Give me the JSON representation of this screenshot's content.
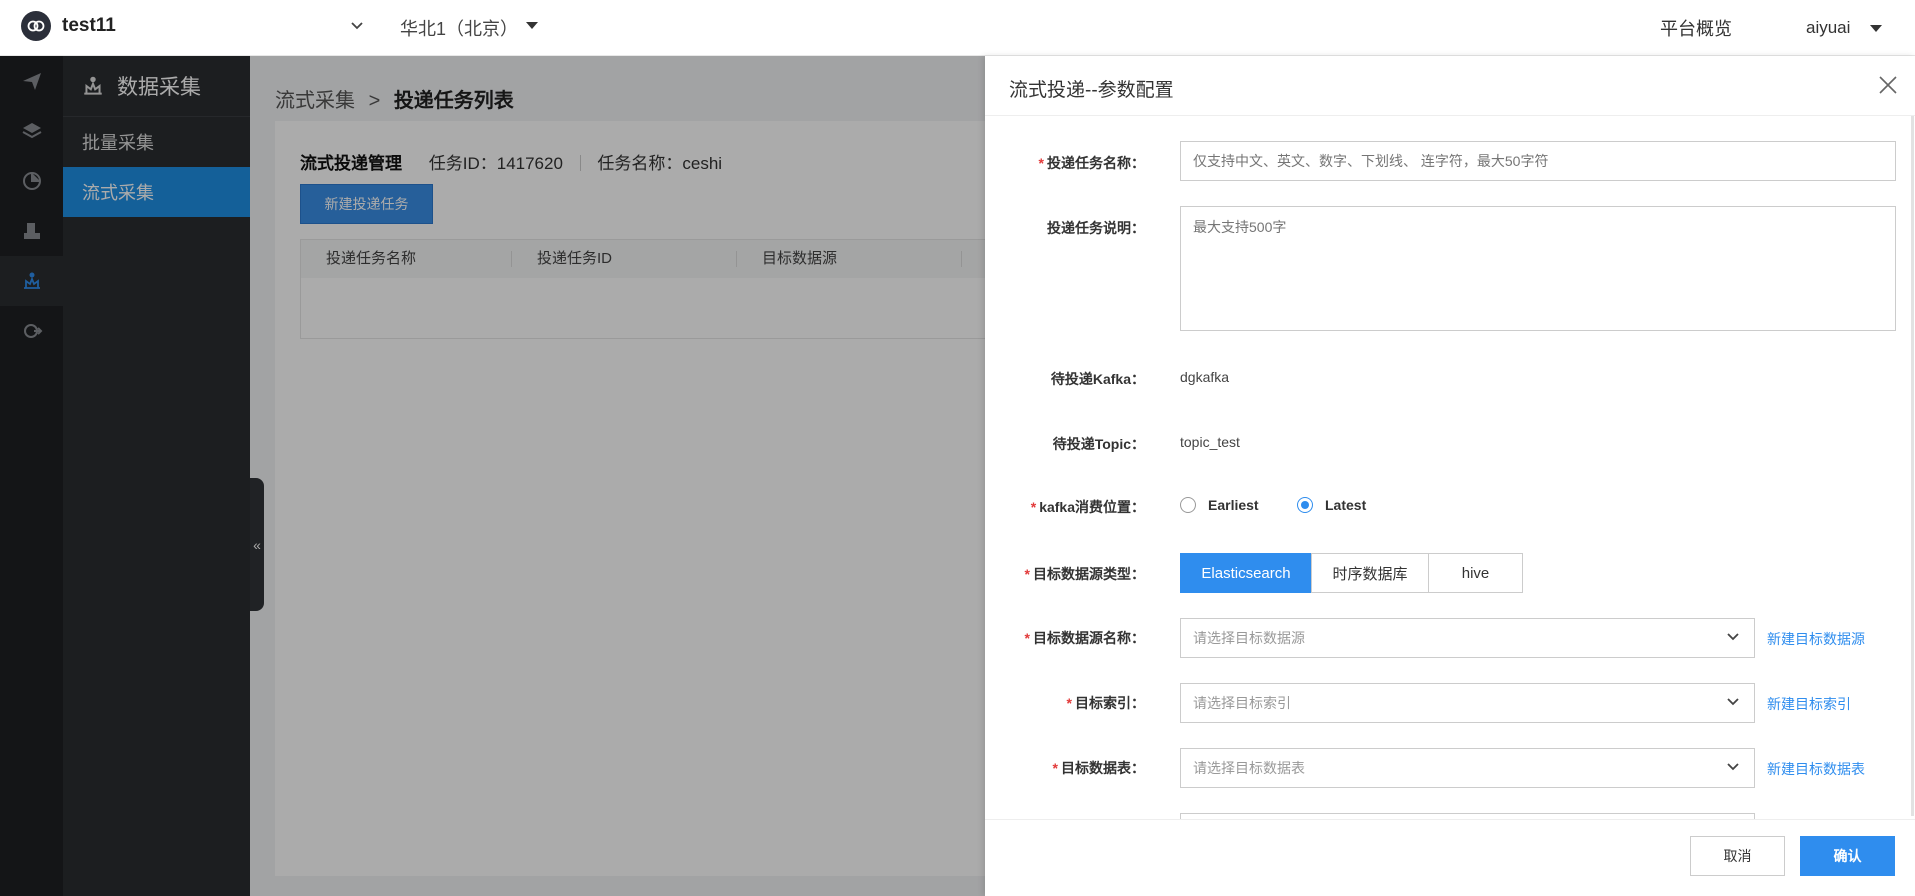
{
  "header": {
    "project": "test11",
    "region": "华北1（北京）",
    "overview": "平台概览",
    "user": "aiyuai"
  },
  "rail": {
    "icons": [
      "send-icon",
      "layers-icon",
      "pie-chart-icon",
      "robot-icon",
      "data-collect-icon",
      "share-icon"
    ],
    "active": "data-collect-icon"
  },
  "sidenav": {
    "title": "数据采集",
    "items": [
      {
        "label": "批量采集",
        "active": false
      },
      {
        "label": "流式采集",
        "active": true
      }
    ]
  },
  "main": {
    "breadcrumb": {
      "parent": "流式采集",
      "separator": ">",
      "current": "投递任务列表"
    },
    "card_title": "流式投递管理",
    "task_id_label": "任务ID：1417620",
    "task_name_label": "任务名称：ceshi",
    "new_button": "新建投递任务",
    "table_headers": [
      "投递任务名称",
      "投递任务ID",
      "目标数据源"
    ]
  },
  "drawer": {
    "title": "流式投递--参数配置",
    "fields": {
      "task_name": {
        "label": "投递任务名称：",
        "required": "*",
        "placeholder": "仅支持中文、英文、数字、下划线、 连字符，最大50字符"
      },
      "task_desc": {
        "label": "投递任务说明：",
        "placeholder": "最大支持500字"
      },
      "kafka": {
        "label": "待投递Kafka：",
        "value": "dgkafka"
      },
      "topic": {
        "label": "待投递Topic：",
        "value": "topic_test"
      },
      "consume": {
        "label": "kafka消费位置：",
        "required": "*",
        "options": [
          "Earliest",
          "Latest"
        ],
        "selected": "Latest"
      },
      "ds_type": {
        "label": "目标数据源类型：",
        "required": "*",
        "options": [
          "Elasticsearch",
          "时序数据库",
          "hive"
        ],
        "selected": "Elasticsearch"
      },
      "ds_name": {
        "label": "目标数据源名称：",
        "required": "*",
        "placeholder": "请选择目标数据源",
        "link": "新建目标数据源"
      },
      "index": {
        "label": "目标索引：",
        "required": "*",
        "placeholder": "请选择目标索引",
        "link": "新建目标索引"
      },
      "table": {
        "label": "目标数据表：",
        "required": "*",
        "placeholder": "请选择目标数据表",
        "link": "新建目标数据表"
      }
    },
    "cancel": "取消",
    "confirm": "确认"
  },
  "colors": {
    "accent": "#2f8dee",
    "rail_bg": "#1e2023",
    "sidenav_bg": "#2b2d30",
    "active_nav": "#1f8fe5",
    "required": "#e23a3a"
  }
}
